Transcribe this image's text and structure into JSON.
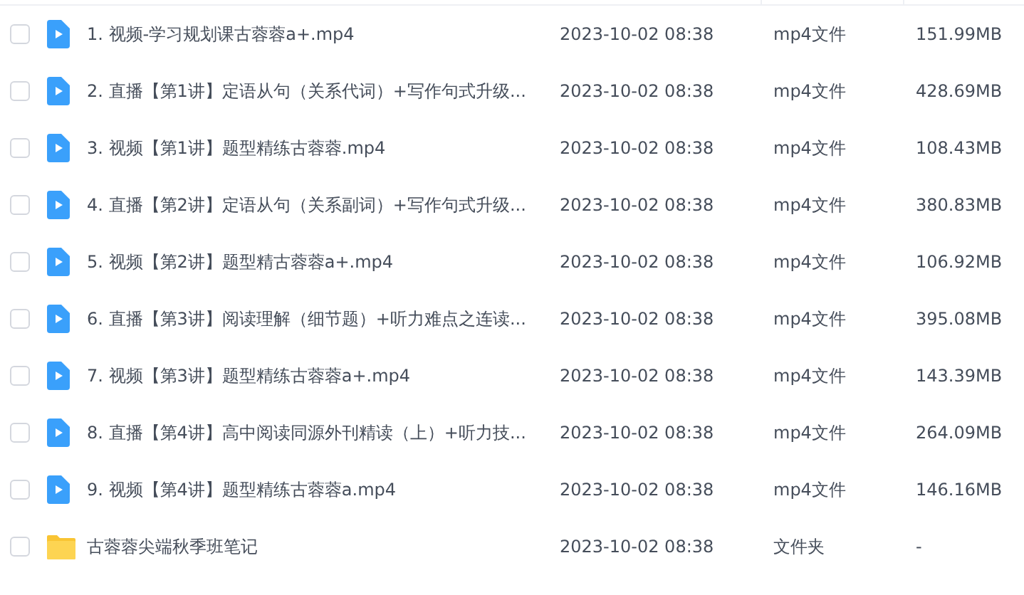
{
  "rows": [
    {
      "kind": "video",
      "checked": false,
      "name": "1. 视频-学习规划课古蓉蓉a+.mp4",
      "date": "2023-10-02 08:38",
      "type": "mp4文件",
      "size": "151.99MB"
    },
    {
      "kind": "video",
      "checked": false,
      "name": "2. 直播【第1讲】定语从句（关系代词）+写作句式升级...",
      "date": "2023-10-02 08:38",
      "type": "mp4文件",
      "size": "428.69MB"
    },
    {
      "kind": "video",
      "checked": false,
      "name": "3. 视频【第1讲】题型精练古蓉蓉.mp4",
      "date": "2023-10-02 08:38",
      "type": "mp4文件",
      "size": "108.43MB"
    },
    {
      "kind": "video",
      "checked": false,
      "name": "4. 直播【第2讲】定语从句（关系副词）+写作句式升级...",
      "date": "2023-10-02 08:38",
      "type": "mp4文件",
      "size": "380.83MB"
    },
    {
      "kind": "video",
      "checked": false,
      "name": "5. 视频【第2讲】题型精古蓉蓉a+.mp4",
      "date": "2023-10-02 08:38",
      "type": "mp4文件",
      "size": "106.92MB"
    },
    {
      "kind": "video",
      "checked": false,
      "name": "6. 直播【第3讲】阅读理解（细节题）+听力难点之连读...",
      "date": "2023-10-02 08:38",
      "type": "mp4文件",
      "size": "395.08MB"
    },
    {
      "kind": "video",
      "checked": false,
      "name": "7. 视频【第3讲】题型精练古蓉蓉a+.mp4",
      "date": "2023-10-02 08:38",
      "type": "mp4文件",
      "size": "143.39MB"
    },
    {
      "kind": "video",
      "checked": false,
      "name": "8. 直播【第4讲】高中阅读同源外刊精读（上）+听力技...",
      "date": "2023-10-02 08:38",
      "type": "mp4文件",
      "size": "264.09MB"
    },
    {
      "kind": "video",
      "checked": false,
      "name": "9. 视频【第4讲】题型精练古蓉蓉a.mp4",
      "date": "2023-10-02 08:38",
      "type": "mp4文件",
      "size": "146.16MB"
    },
    {
      "kind": "folder",
      "checked": false,
      "name": "古蓉蓉尖端秋季班笔记",
      "date": "2023-10-02 08:38",
      "type": "文件夹",
      "size": "-"
    }
  ]
}
